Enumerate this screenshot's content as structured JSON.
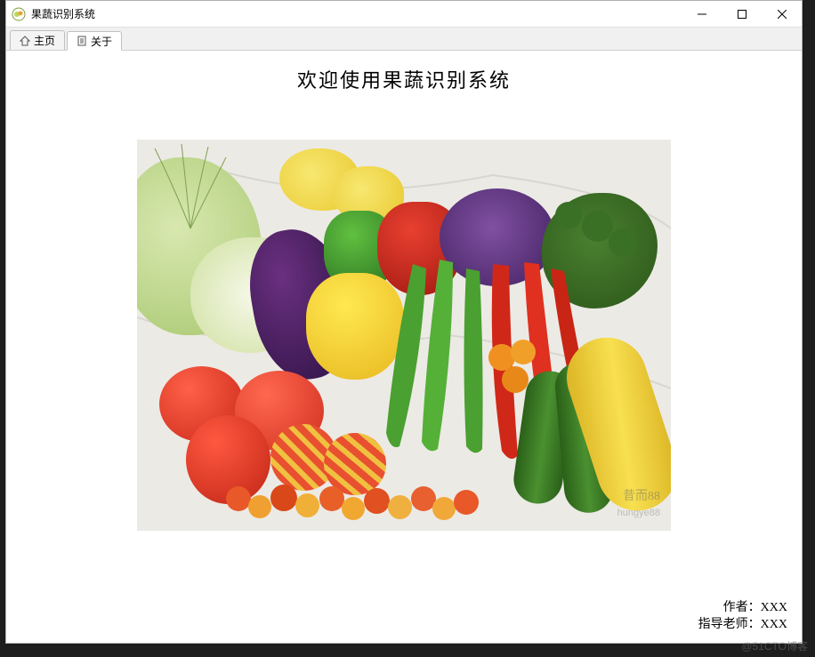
{
  "window": {
    "title": "果蔬识别系统"
  },
  "tabs": [
    {
      "label": "主页",
      "icon": "home-icon",
      "active": false
    },
    {
      "label": "关于",
      "icon": "document-icon",
      "active": true
    }
  ],
  "content": {
    "welcome_title": "欢迎使用果蔬识别系统",
    "image_watermark_main": "昔而88",
    "image_watermark_sub": "hungye88"
  },
  "credits": {
    "author_label": "作者：",
    "author_value": "XXX",
    "advisor_label": "指导老师：",
    "advisor_value": "XXX"
  },
  "page_watermark": "@51CTO博客"
}
